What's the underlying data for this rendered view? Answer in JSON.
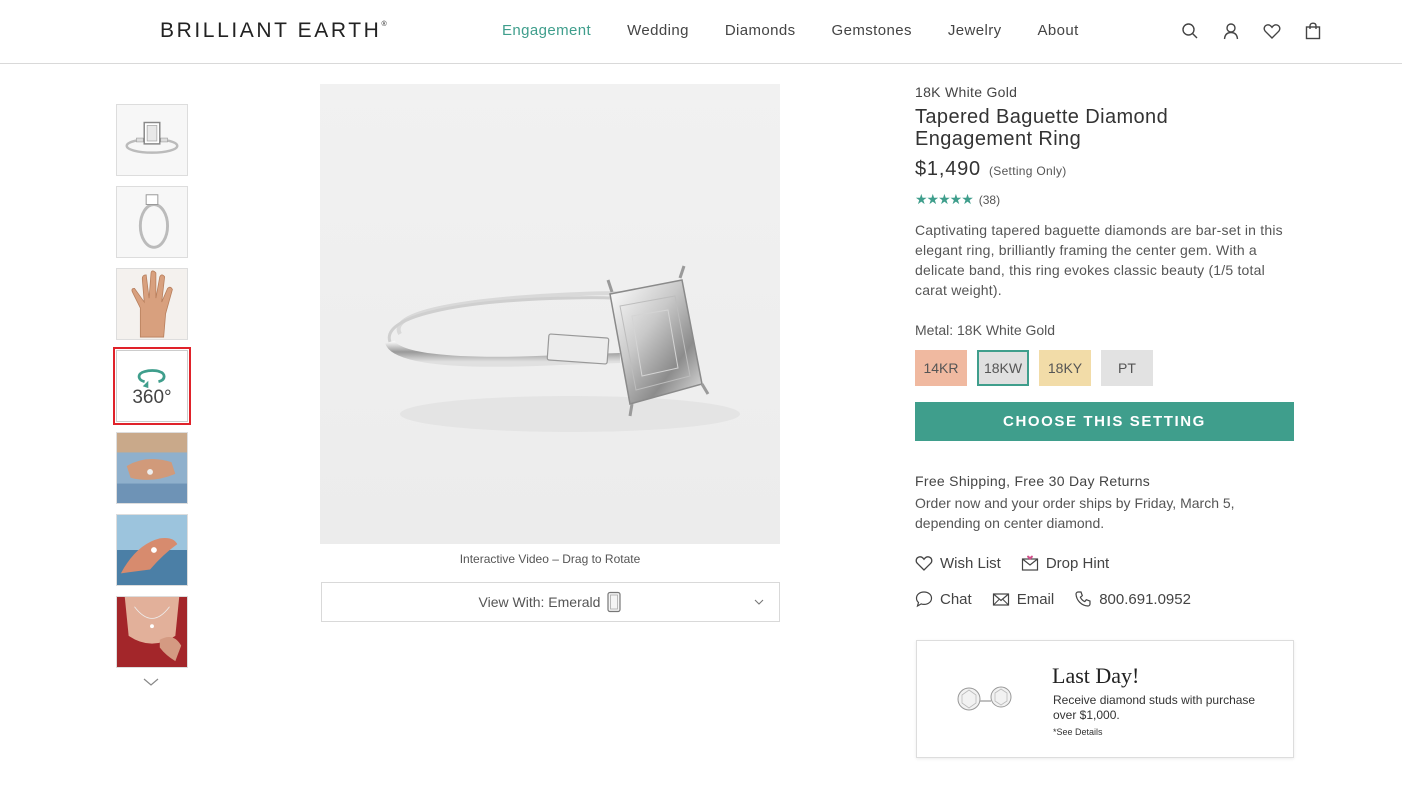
{
  "header": {
    "logo": "BRILLIANT EARTH",
    "logo_mark": "®",
    "nav": [
      {
        "label": "Engagement",
        "active": true
      },
      {
        "label": "Wedding"
      },
      {
        "label": "Diamonds"
      },
      {
        "label": "Gemstones"
      },
      {
        "label": "Jewelry"
      },
      {
        "label": "About"
      }
    ],
    "icons": [
      "search-icon",
      "account-icon",
      "wishlist-heart-icon",
      "shopping-bag-icon"
    ]
  },
  "gallery": {
    "thumb_360_label": "360°",
    "caption": "Interactive Video – Drag to Rotate",
    "view_with_label": "View With: Emerald"
  },
  "product": {
    "metal_top": "18K White Gold",
    "title_line1": "Tapered Baguette Diamond",
    "title_line2": "Engagement Ring",
    "price": "$1,490",
    "price_note": "(Setting Only)",
    "stars": "★★★★★",
    "rating_count": "(38)",
    "description": "Captivating tapered baguette diamonds are bar-set in this elegant ring, brilliantly framing the center gem. With a delicate band, this ring evokes classic beauty (1/5 total carat weight).",
    "metal_label": "Metal: 18K White Gold",
    "swatches": [
      "14KR",
      "18KW",
      "18KY",
      "PT"
    ],
    "cta": "CHOOSE THIS SETTING"
  },
  "shipping": {
    "title": "Free Shipping, Free 30 Day Returns",
    "text": "Order now and your order ships by Friday, March 5, depending on center diamond."
  },
  "actions": {
    "wishlist": "Wish List",
    "drop_hint": "Drop Hint",
    "chat": "Chat",
    "email": "Email",
    "phone": "800.691.0952"
  },
  "promo": {
    "title": "Last Day!",
    "text": "Receive diamond studs with purchase over $1,000.",
    "link": "*See Details"
  },
  "colors": {
    "accent": "#3f9e8c",
    "selected_outline": "#e0222a",
    "rose_swatch": "#f0b9a0",
    "yellow_swatch": "#f2dca8"
  }
}
